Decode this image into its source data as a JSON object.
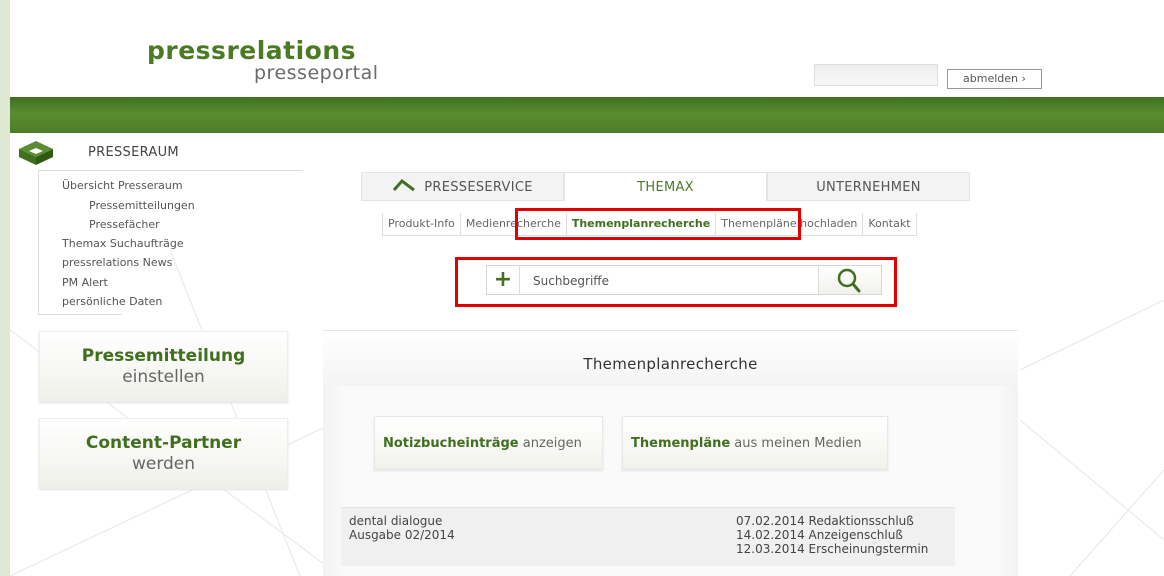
{
  "header": {
    "logo_main": "pressrelations",
    "logo_sub": "presseportal",
    "logout_label": "abmelden ›"
  },
  "left": {
    "section_title": "PRESSERAUM",
    "nav": [
      {
        "label": "Übersicht Presseraum"
      },
      {
        "label": "Pressemitteilungen"
      },
      {
        "label": "Pressefächer"
      },
      {
        "label": "Themax Suchaufträge"
      },
      {
        "label": "pressrelations News"
      },
      {
        "label": "PM Alert"
      },
      {
        "label": "persönliche Daten"
      }
    ],
    "promo1": {
      "line1": "Pressemitteilung",
      "line2": "einstellen"
    },
    "promo2": {
      "line1": "Content-Partner",
      "line2": "werden"
    }
  },
  "tabs": [
    {
      "label": "PRESSESERVICE"
    },
    {
      "label": "THEMAX"
    },
    {
      "label": "UNTERNEHMEN"
    }
  ],
  "subnav": [
    {
      "label": "Produkt-Info"
    },
    {
      "label": "Medienrecherche"
    },
    {
      "label": "Themenplanrecherche"
    },
    {
      "label": "Themenpläne hochladen"
    },
    {
      "label": "Kontakt"
    }
  ],
  "search": {
    "placeholder": "Suchbegriffe"
  },
  "content": {
    "title": "Themenplanrecherche",
    "btn1": {
      "bold": "Notizbucheinträge",
      "rest": " anzeigen"
    },
    "btn2": {
      "bold": "Themenpläne",
      "rest": " aus meinen Medien"
    },
    "entry": {
      "name": "dental dialogue",
      "issue": "Ausgabe 02/2014",
      "dates": [
        "07.02.2014 Redaktionsschluß",
        "14.02.2014 Anzeigenschluß",
        "12.03.2014 Erscheinungstermin"
      ]
    }
  },
  "colors": {
    "brand_green": "#4a7a22",
    "highlight_red": "#e00000",
    "outer_bg": "#dfe8d3"
  }
}
